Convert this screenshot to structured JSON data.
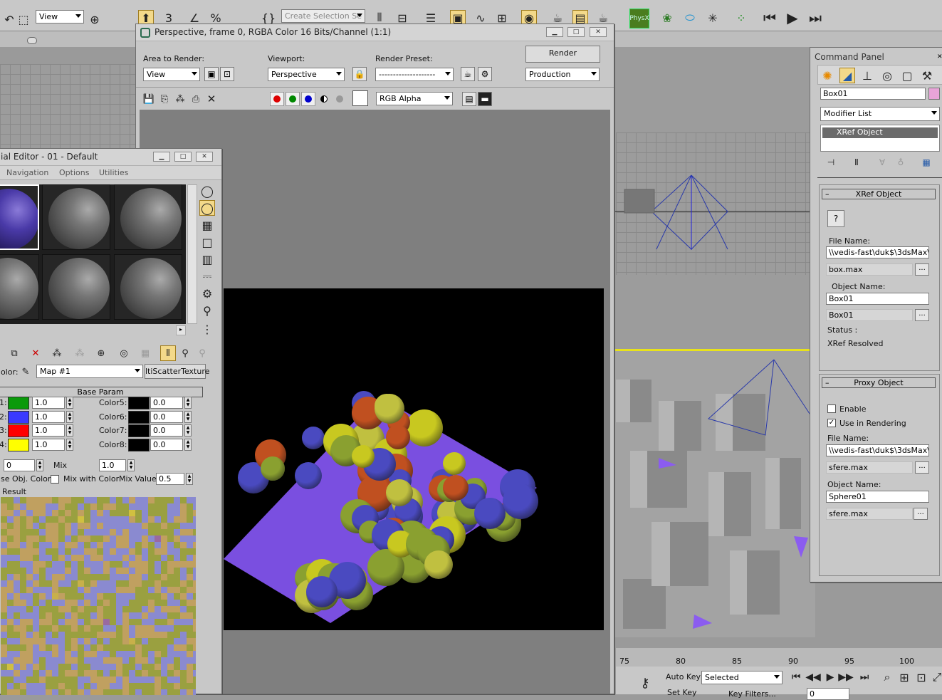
{
  "toolbar": {
    "view_combo": "View",
    "selection_set": "Create Selection Se",
    "physx_label": "PhysX"
  },
  "render_frame": {
    "title": "Perspective, frame 0, RGBA Color 16 Bits/Channel (1:1)",
    "area_label": "Area to Render:",
    "area_value": "View",
    "viewport_label": "Viewport:",
    "viewport_value": "Perspective",
    "preset_label": "Render Preset:",
    "preset_value": "--------------------",
    "render_button": "Render",
    "mode_value": "Production",
    "channel_value": "RGB Alpha"
  },
  "material_editor": {
    "title": "ial Editor - 01 - Default",
    "menu": [
      "Navigation",
      "Options",
      "Utilities"
    ],
    "color_label": "olor:",
    "map_name": "Map #1",
    "map_type": "ltiScatterTexture",
    "base_param": "Base Param",
    "left_rows": [
      {
        "label": "1:",
        "color": "#0a9a0a",
        "value": "1.0"
      },
      {
        "label": "2:",
        "color": "#3a3aff",
        "value": "1.0"
      },
      {
        "label": "3:",
        "color": "#ff0000",
        "value": "1.0"
      },
      {
        "label": "4:",
        "color": "#ffff00",
        "value": "1.0"
      }
    ],
    "right_rows": [
      {
        "label": "Color5:",
        "color": "#000000",
        "value": "0.0"
      },
      {
        "label": "Color6:",
        "color": "#000000",
        "value": "0.0"
      },
      {
        "label": "Color7:",
        "color": "#000000",
        "value": "0.0"
      },
      {
        "label": "Color8:",
        "color": "#000000",
        "value": "0.0"
      }
    ],
    "extra_value": "0",
    "mix_label": "Mix",
    "mix_value": "1.0",
    "use_obj_label": "se Obj. Color",
    "mix_with_label": "Mix with Color",
    "mix_value_label": "Mix Value:",
    "mix_value_value": "0.5",
    "result_label": "Result"
  },
  "command_panel": {
    "title": "Command Panel",
    "object_name": "Box01",
    "modifier_list": "Modifier List",
    "stack_item": "XRef Object",
    "xref_title": "XRef Object",
    "xref_file_label": "File Name:",
    "xref_file_path": "\\\\vedis-fast\\duk$\\3dsMax\\sc",
    "xref_file_short": "box.max",
    "xref_obj_label": "Object Name:",
    "xref_obj_name": "Box01",
    "xref_obj_short": "Box01",
    "status_label": "Status :",
    "status_value": "XRef Resolved",
    "proxy_title": "Proxy Object",
    "enable_label": "Enable",
    "use_rendering_label": "Use in Rendering",
    "proxy_file_label": "File Name:",
    "proxy_file_path": "\\\\vedis-fast\\duk$\\3dsMax\\sc",
    "proxy_file_short": "sfere.max",
    "proxy_obj_label": "Object Name:",
    "proxy_obj_name": "Sphere01",
    "proxy_obj_short": "sfere.max",
    "browse": "..."
  },
  "timeline": {
    "ticks": [
      "75",
      "80",
      "85",
      "90",
      "95",
      "100"
    ],
    "auto_key": "Auto Key",
    "set_key": "Set Key",
    "selected": "Selected",
    "key_filters": "Key Filters...",
    "frame": "0"
  }
}
